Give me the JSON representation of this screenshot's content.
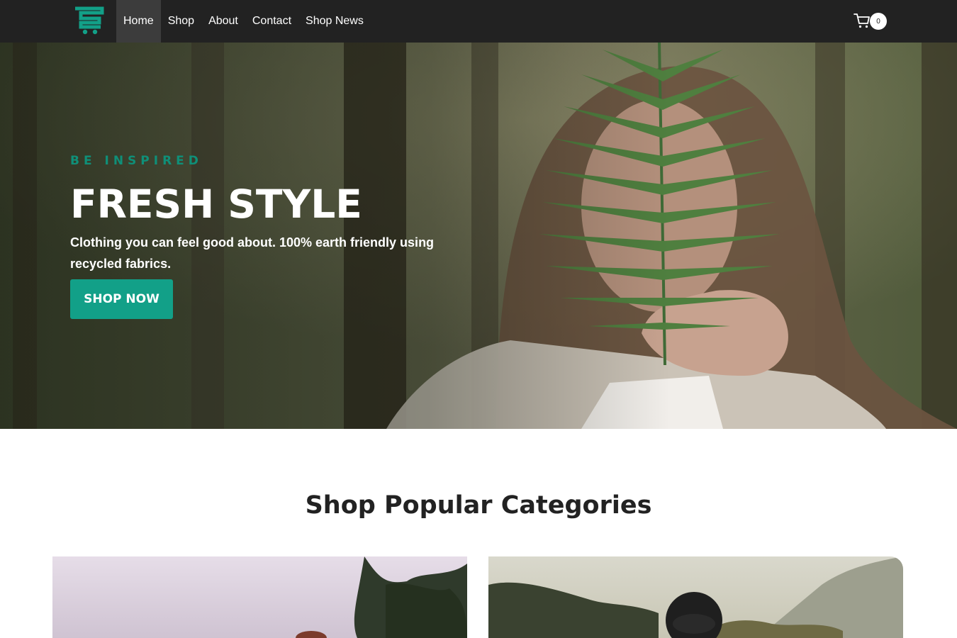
{
  "header": {
    "logo_icon": "cart-logo-icon",
    "nav": [
      {
        "label": "Home",
        "active": true
      },
      {
        "label": "Shop",
        "active": false
      },
      {
        "label": "About",
        "active": false
      },
      {
        "label": "Contact",
        "active": false
      },
      {
        "label": "Shop News",
        "active": false
      }
    ],
    "cart_icon": "shopping-cart-icon",
    "cart_count": "0"
  },
  "hero": {
    "eyebrow": "BE INSPIRED",
    "title": "FRESH STYLE",
    "subtitle": "Clothing you can feel good about. 100% earth friendly using recycled fabrics.",
    "button_label": "SHOP NOW"
  },
  "categories": {
    "title": "Shop Popular Categories"
  },
  "colors": {
    "accent": "#12a088",
    "header_bg": "#222222",
    "active_nav_bg": "#3c3c3c"
  }
}
